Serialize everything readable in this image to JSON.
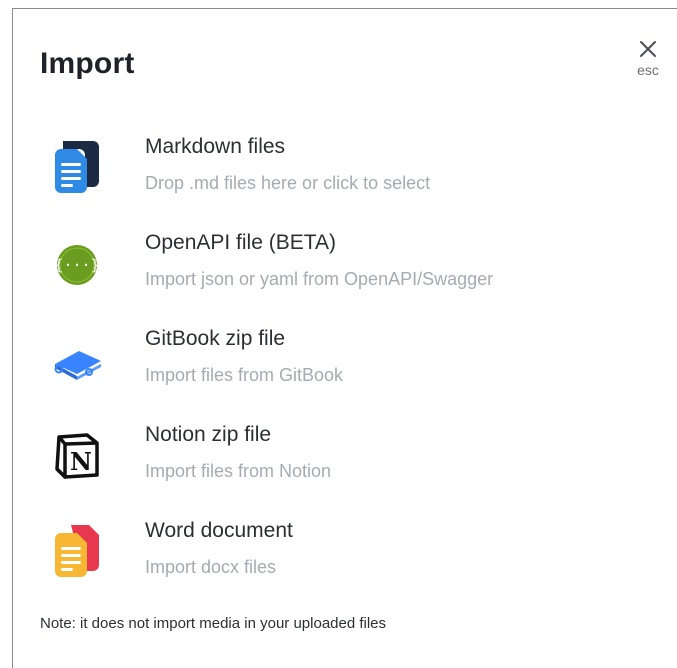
{
  "dialog": {
    "title": "Import",
    "close_label": "esc",
    "note": "Note: it does not import media in your uploaded files"
  },
  "options": [
    {
      "title": "Markdown files",
      "description": "Drop .md files here or click to select",
      "icon": "markdown-file-icon"
    },
    {
      "title": "OpenAPI file (BETA)",
      "description": "Import json or yaml from OpenAPI/Swagger",
      "icon": "openapi-icon"
    },
    {
      "title": "GitBook zip file",
      "description": "Import files from GitBook",
      "icon": "gitbook-icon"
    },
    {
      "title": "Notion zip file",
      "description": "Import files from Notion",
      "icon": "notion-icon"
    },
    {
      "title": "Word document",
      "description": "Import docx files",
      "icon": "word-document-icon"
    }
  ],
  "colors": {
    "markdown_blue": "#2f8ae6",
    "markdown_dark": "#1c2a44",
    "openapi_green": "#6a9c1f",
    "gitbook_blue": "#3884ff",
    "notion_black": "#111111",
    "word_orange": "#f7b733",
    "word_red": "#e8384f"
  }
}
